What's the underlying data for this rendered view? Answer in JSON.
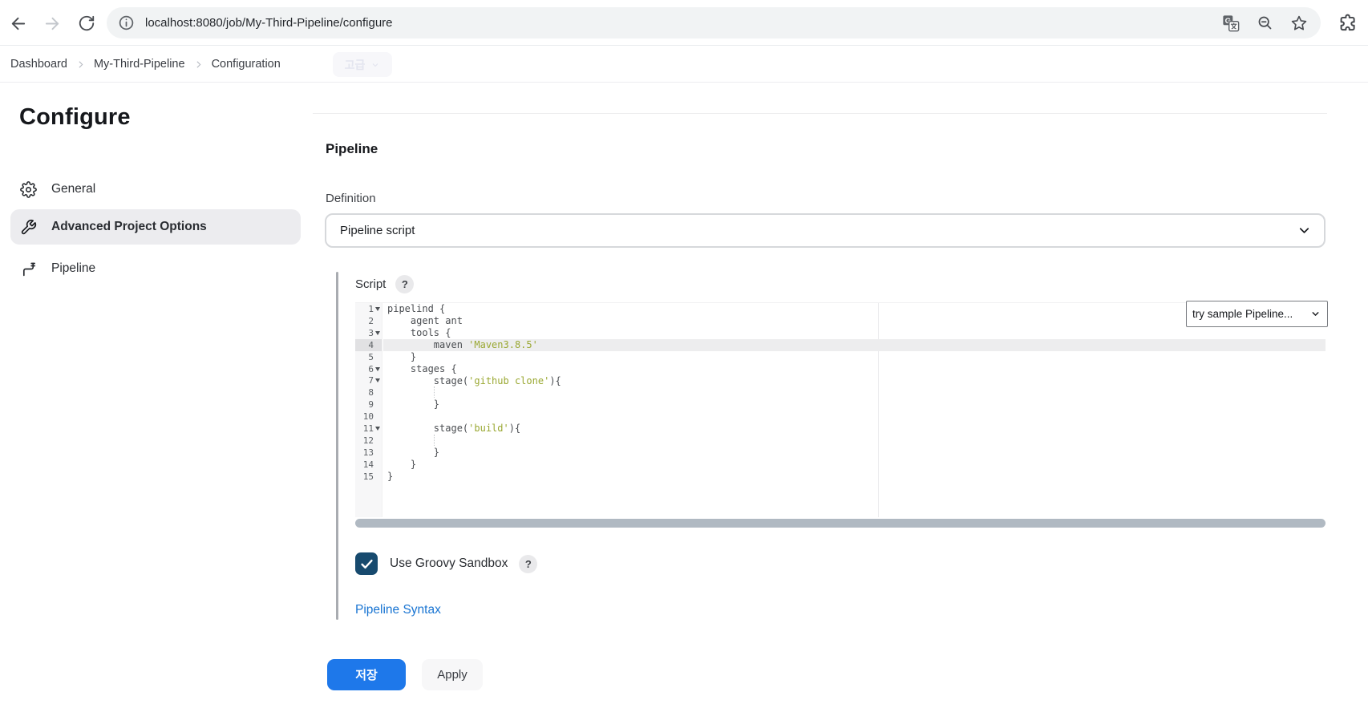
{
  "browser": {
    "url": "localhost:8080/job/My-Third-Pipeline/configure"
  },
  "breadcrumb": {
    "items": [
      "Dashboard",
      "My-Third-Pipeline",
      "Configuration"
    ],
    "ghost_label": "고급"
  },
  "sidebar": {
    "title": "Configure",
    "items": [
      {
        "label": "General",
        "icon": "gear-icon",
        "active": false
      },
      {
        "label": "Advanced Project Options",
        "icon": "wrench-icon",
        "active": true
      },
      {
        "label": "Pipeline",
        "icon": "pipeline-icon",
        "active": false
      }
    ]
  },
  "pipeline_section": {
    "title": "Pipeline",
    "definition_label": "Definition",
    "definition_value": "Pipeline script",
    "script_label": "Script",
    "help_badge": "?",
    "sample_select_value": "try sample Pipeline...",
    "sandbox_label": "Use Groovy Sandbox",
    "sandbox_checked": true,
    "syntax_link": "Pipeline Syntax",
    "save_button": "저장",
    "apply_button": "Apply"
  },
  "editor": {
    "active_line": 4,
    "lines": [
      {
        "n": 1,
        "fold": true,
        "segments": [
          {
            "text": "pipelind {"
          }
        ]
      },
      {
        "n": 2,
        "segments": [
          {
            "text": "    agent ant"
          }
        ]
      },
      {
        "n": 3,
        "fold": true,
        "segments": [
          {
            "text": "    tools {"
          }
        ]
      },
      {
        "n": 4,
        "segments": [
          {
            "text": "        maven "
          },
          {
            "text": "'Maven3.8.5'",
            "type": "string"
          }
        ]
      },
      {
        "n": 5,
        "segments": [
          {
            "text": "    }"
          }
        ]
      },
      {
        "n": 6,
        "fold": true,
        "segments": [
          {
            "text": "    stages {"
          }
        ]
      },
      {
        "n": 7,
        "fold": true,
        "segments": [
          {
            "text": "        stage("
          },
          {
            "text": "'github clone'",
            "type": "string"
          },
          {
            "text": "){"
          }
        ]
      },
      {
        "n": 8,
        "guide_col": 8,
        "segments": []
      },
      {
        "n": 9,
        "segments": [
          {
            "text": "        }"
          }
        ]
      },
      {
        "n": 10,
        "segments": []
      },
      {
        "n": 11,
        "fold": true,
        "segments": [
          {
            "text": "        stage("
          },
          {
            "text": "'build'",
            "type": "string"
          },
          {
            "text": "){"
          }
        ]
      },
      {
        "n": 12,
        "guide_col": 8,
        "segments": []
      },
      {
        "n": 13,
        "segments": [
          {
            "text": "        }"
          }
        ]
      },
      {
        "n": 14,
        "segments": [
          {
            "text": "    }"
          }
        ]
      },
      {
        "n": 15,
        "segments": [
          {
            "text": "}"
          }
        ]
      }
    ]
  },
  "colors": {
    "accent_blue": "#1e78ea",
    "link_blue": "#1874d2",
    "checkbox_navy": "#174a6e",
    "string_olive": "#9aa832",
    "scrollbar_gray": "#b0b9c2"
  }
}
